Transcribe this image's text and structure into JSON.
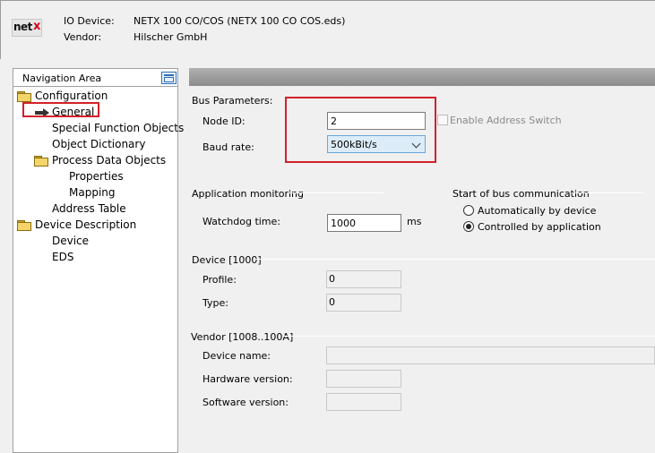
{
  "header": {
    "logo_text": "net",
    "logo_accent": "x",
    "io_device_label": "IO Device:",
    "io_device_value": "NETX 100 CO/COS (NETX 100 CO COS.eds)",
    "vendor_label": "Vendor:",
    "vendor_value": "Hilscher GmbH"
  },
  "nav": {
    "title": "Navigation Area",
    "items": [
      {
        "label": "Configuration",
        "icon": "folder-icon"
      },
      {
        "label": "General",
        "icon": "hand-pointer-icon",
        "selected": true
      },
      {
        "label": "Special Function Objects"
      },
      {
        "label": "Object Dictionary"
      },
      {
        "label": "Process Data Objects",
        "icon": "folder-icon"
      },
      {
        "label": "Properties"
      },
      {
        "label": "Mapping"
      },
      {
        "label": "Address Table"
      },
      {
        "label": "Device Description",
        "icon": "folder-icon"
      },
      {
        "label": "Device"
      },
      {
        "label": "EDS"
      }
    ]
  },
  "bus": {
    "title": "Bus Parameters:",
    "node_id_label": "Node ID:",
    "node_id_value": "2",
    "enable_switch_label": "Enable Address Switch",
    "enable_switch_checked": false,
    "baud_label": "Baud rate:",
    "baud_value": "500kBit/s"
  },
  "monitoring": {
    "title": "Application monitoring",
    "watchdog_label": "Watchdog time:",
    "watchdog_value": "1000",
    "watchdog_unit": "ms"
  },
  "start": {
    "title": "Start of bus communication",
    "option_auto": "Automatically by device",
    "option_app": "Controlled by application",
    "selected": "Controlled by application"
  },
  "device": {
    "title": "Device [1000]",
    "profile_label": "Profile:",
    "profile_value": "0",
    "type_label": "Type:",
    "type_value": "0"
  },
  "vendor": {
    "title": "Vendor [1008..100A]",
    "device_name_label": "Device name:",
    "device_name_value": "",
    "hw_label": "Hardware version:",
    "hw_value": "",
    "sw_label": "Software version:",
    "sw_value": ""
  },
  "colors": {
    "highlight_red": "#d4202a",
    "selected_field": "#dcecf8"
  }
}
